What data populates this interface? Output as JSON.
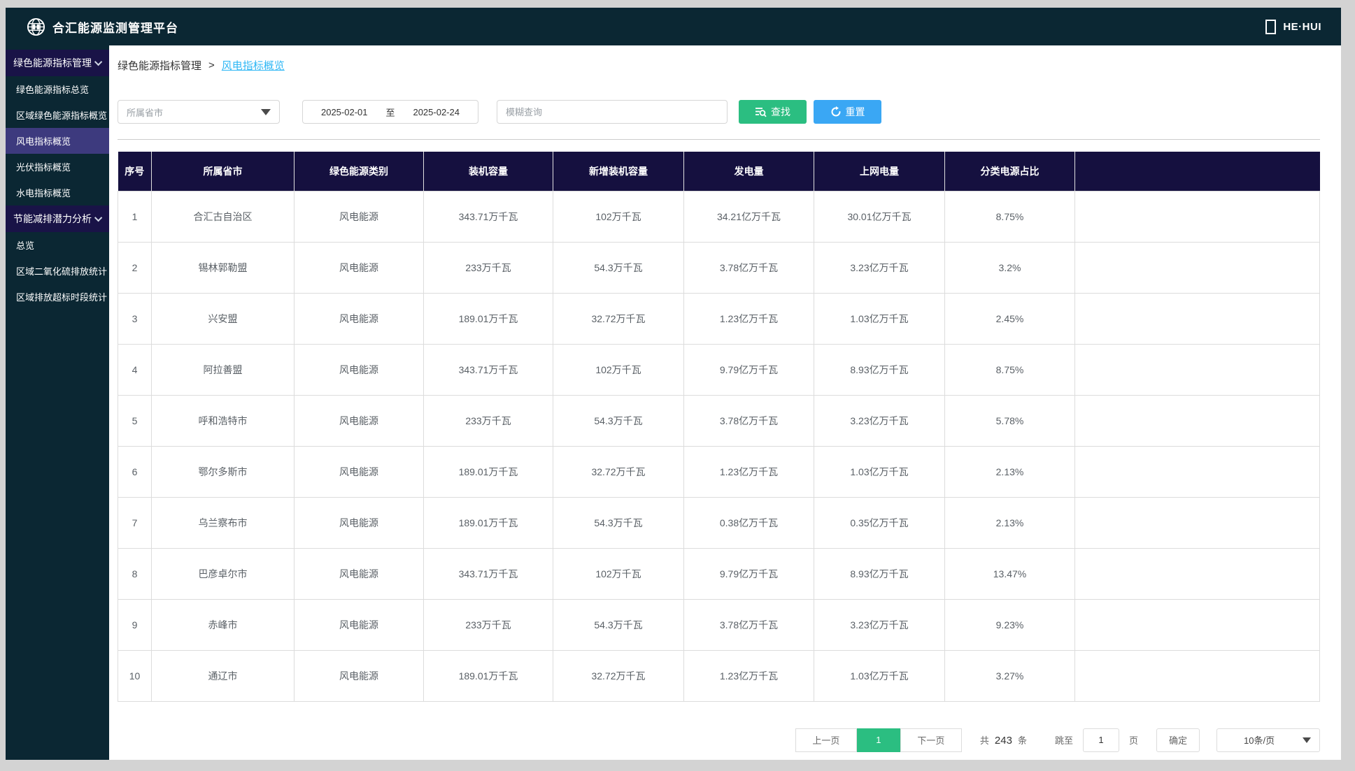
{
  "app": {
    "title": "合汇能源监测管理平台",
    "brand": "HE·HUI"
  },
  "sidebar": {
    "items": [
      {
        "label": "绿色能源指标管理",
        "type": "group"
      },
      {
        "label": "绿色能源指标总览",
        "type": "item"
      },
      {
        "label": "区域绿色能源指标概览",
        "type": "item"
      },
      {
        "label": "风电指标概览",
        "type": "item",
        "selected": true
      },
      {
        "label": "光伏指标概览",
        "type": "item"
      },
      {
        "label": "水电指标概览",
        "type": "item"
      },
      {
        "label": "节能减排潜力分析",
        "type": "group"
      },
      {
        "label": "总览",
        "type": "item"
      },
      {
        "label": "区域二氧化硫排放统计",
        "type": "item"
      },
      {
        "label": "区域排放超标时段统计",
        "type": "item"
      }
    ]
  },
  "breadcrumb": {
    "parent": "绿色能源指标管理",
    "separator": ">",
    "current": "风电指标概览"
  },
  "filters": {
    "province_placeholder": "所属省市",
    "date_start": "2025-02-01",
    "date_to_label": "至",
    "date_end": "2025-02-24",
    "search_placeholder": "模糊查询",
    "find_label": "查找",
    "reset_label": "重置"
  },
  "table": {
    "headers": [
      "序号",
      "所属省市",
      "绿色能源类别",
      "装机容量",
      "新增装机容量",
      "发电量",
      "上网电量",
      "分类电源占比"
    ],
    "rows": [
      [
        "1",
        "合汇古自治区",
        "风电能源",
        "343.71万千瓦",
        "102万千瓦",
        "34.21亿万千瓦",
        "30.01亿万千瓦",
        "8.75%"
      ],
      [
        "2",
        "锡林郭勒盟",
        "风电能源",
        "233万千瓦",
        "54.3万千瓦",
        "3.78亿万千瓦",
        "3.23亿万千瓦",
        "3.2%"
      ],
      [
        "3",
        "兴安盟",
        "风电能源",
        "189.01万千瓦",
        "32.72万千瓦",
        "1.23亿万千瓦",
        "1.03亿万千瓦",
        "2.45%"
      ],
      [
        "4",
        "阿拉善盟",
        "风电能源",
        "343.71万千瓦",
        "102万千瓦",
        "9.79亿万千瓦",
        "8.93亿万千瓦",
        "8.75%"
      ],
      [
        "5",
        "呼和浩特市",
        "风电能源",
        "233万千瓦",
        "54.3万千瓦",
        "3.78亿万千瓦",
        "3.23亿万千瓦",
        "5.78%"
      ],
      [
        "6",
        "鄂尔多斯市",
        "风电能源",
        "189.01万千瓦",
        "32.72万千瓦",
        "1.23亿万千瓦",
        "1.03亿万千瓦",
        "2.13%"
      ],
      [
        "7",
        "乌兰察布市",
        "风电能源",
        "189.01万千瓦",
        "54.3万千瓦",
        "0.38亿万千瓦",
        "0.35亿万千瓦",
        "2.13%"
      ],
      [
        "8",
        "巴彦卓尔市",
        "风电能源",
        "343.71万千瓦",
        "102万千瓦",
        "9.79亿万千瓦",
        "8.93亿万千瓦",
        "13.47%"
      ],
      [
        "9",
        "赤峰市",
        "风电能源",
        "233万千瓦",
        "54.3万千瓦",
        "3.78亿万千瓦",
        "3.23亿万千瓦",
        "9.23%"
      ],
      [
        "10",
        "通辽市",
        "风电能源",
        "189.01万千瓦",
        "32.72万千瓦",
        "1.23亿万千瓦",
        "1.03亿万千瓦",
        "3.27%"
      ]
    ]
  },
  "pagination": {
    "prev": "上一页",
    "current_page": "1",
    "next": "下一页",
    "total_prefix": "共",
    "total_count": "243",
    "total_suffix": "条",
    "jump_label": "跳至",
    "jump_value": "1",
    "jump_suffix": "页",
    "confirm": "确定",
    "page_size": "10条/页"
  },
  "colors": {
    "topbar_bg": "#0b2733",
    "group_bg": "#191347",
    "selected_bg": "#3d3a7e",
    "table_header_bg": "#15103f",
    "accent_green": "#2bbe81",
    "accent_blue": "#3aa7f4",
    "breadcrumb_link": "#2eb7f5"
  }
}
